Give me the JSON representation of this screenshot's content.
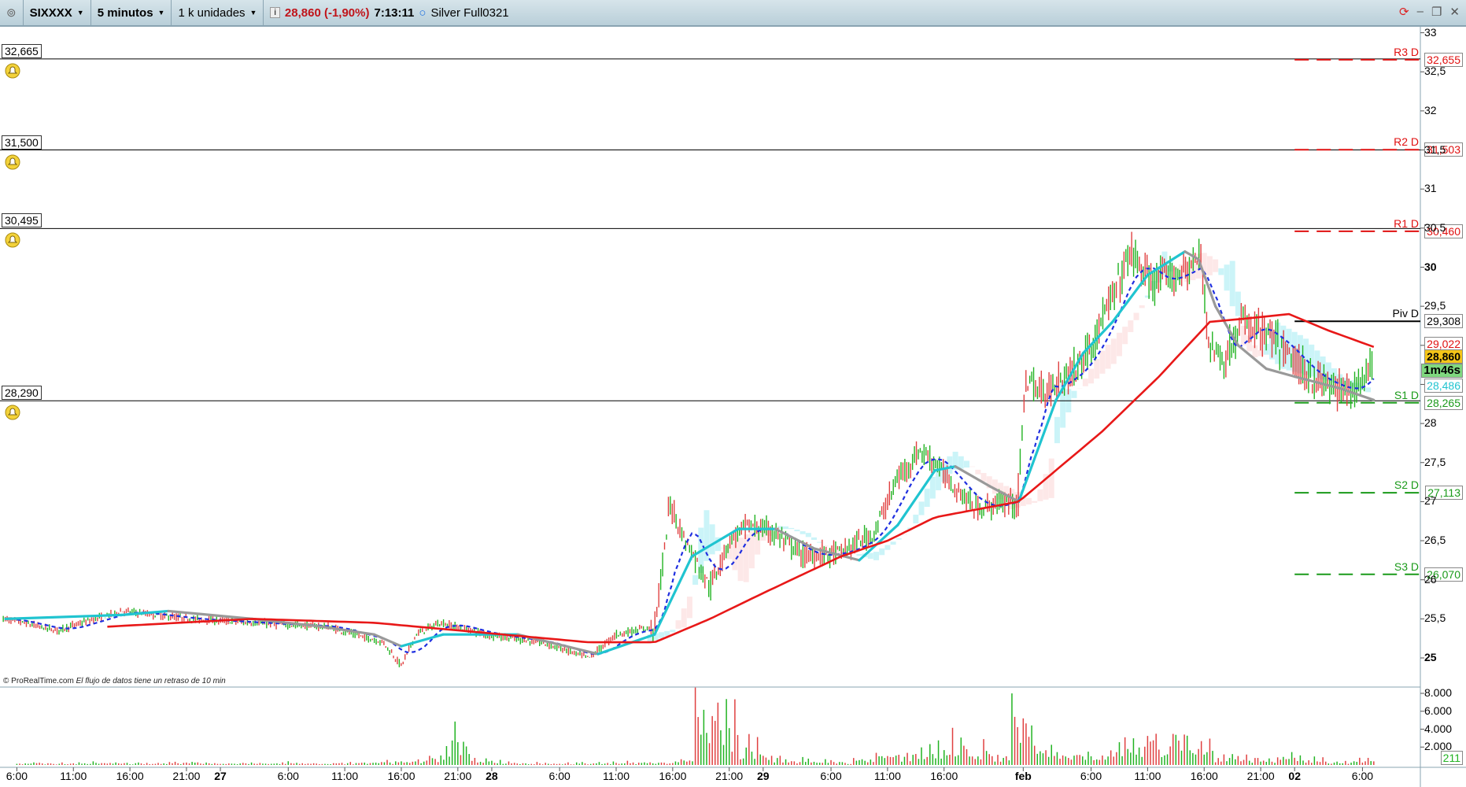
{
  "toolbar": {
    "symbol": "SIXXXX",
    "timeframe": "5 minutos",
    "units": "1 k unidades",
    "price": "28,860 (-1,90%)",
    "time": "7:13:11",
    "instrument": "Silver Full0321"
  },
  "credit": {
    "brand": "© ProRealTime.com",
    "note": "El flujo de datos tiene un retraso de 10 min"
  },
  "alerts": [
    {
      "label": "32,665",
      "value": 32.665
    },
    {
      "label": "31,500",
      "value": 31.5
    },
    {
      "label": "30,495",
      "value": 30.495
    },
    {
      "label": "28,290",
      "value": 28.29
    }
  ],
  "pivots": [
    {
      "name": "R3 D",
      "label": "32,655",
      "value": 32.655,
      "color": "#e01010"
    },
    {
      "name": "R2 D",
      "label": "31,503",
      "value": 31.503,
      "color": "#e01010"
    },
    {
      "name": "R1 D",
      "label": "30,460",
      "value": 30.46,
      "color": "#e01010"
    },
    {
      "name": "Piv D",
      "label": "29,308",
      "value": 29.308,
      "color": "#000000"
    },
    {
      "name": "S1 D",
      "label": "28,265",
      "value": 28.265,
      "color": "#1a9a1a"
    },
    {
      "name": "S2 D",
      "label": "27,113",
      "value": 27.113,
      "color": "#1a9a1a"
    },
    {
      "name": "S3 D",
      "label": "26,070",
      "value": 26.07,
      "color": "#1a9a1a"
    }
  ],
  "right_labels": {
    "ma_red": "29,022",
    "last": "28,860",
    "countdown": "1m46s",
    "ma_cyan": "28,486",
    "volume": "211"
  },
  "price_axis": [
    "33",
    "32,5",
    "32",
    "31,5",
    "31",
    "30,5",
    "30",
    "29,5",
    "29",
    "28,5",
    "28",
    "27,5",
    "27",
    "26,5",
    "26",
    "25,5",
    "25"
  ],
  "volume_axis": [
    "8.000",
    "6.000",
    "4.000",
    "2.000"
  ],
  "time_axis": [
    {
      "t": 0,
      "l": "6:00"
    },
    {
      "t": 5,
      "l": "11:00"
    },
    {
      "t": 10,
      "l": "16:00"
    },
    {
      "t": 15,
      "l": "21:00"
    },
    {
      "t": 18,
      "l": "27",
      "b": 1
    },
    {
      "t": 24,
      "l": "6:00"
    },
    {
      "t": 29,
      "l": "11:00"
    },
    {
      "t": 34,
      "l": "16:00"
    },
    {
      "t": 39,
      "l": "21:00"
    },
    {
      "t": 42,
      "l": "28",
      "b": 1
    },
    {
      "t": 48,
      "l": "6:00"
    },
    {
      "t": 53,
      "l": "11:00"
    },
    {
      "t": 58,
      "l": "16:00"
    },
    {
      "t": 63,
      "l": "21:00"
    },
    {
      "t": 66,
      "l": "29",
      "b": 1
    },
    {
      "t": 72,
      "l": "6:00"
    },
    {
      "t": 77,
      "l": "11:00"
    },
    {
      "t": 82,
      "l": "16:00"
    },
    {
      "t": 89,
      "l": "feb",
      "b": 1
    },
    {
      "t": 95,
      "l": "6:00"
    },
    {
      "t": 100,
      "l": "11:00"
    },
    {
      "t": 105,
      "l": "16:00"
    },
    {
      "t": 110,
      "l": "21:00"
    },
    {
      "t": 113,
      "l": "02",
      "b": 1
    },
    {
      "t": 119,
      "l": "6:00"
    }
  ],
  "chart_data": {
    "type": "line",
    "ylim": [
      25,
      33
    ],
    "volume_ylim": [
      0,
      8000
    ],
    "price": [
      [
        -1.1,
        25.5
      ],
      [
        3.5,
        25.35
      ],
      [
        9.3,
        25.6
      ],
      [
        15,
        25.5
      ],
      [
        20.8,
        25.45
      ],
      [
        27.4,
        25.4
      ],
      [
        32.4,
        25.2
      ],
      [
        34,
        24.9
      ],
      [
        35.3,
        25.3
      ],
      [
        37.4,
        25.45
      ],
      [
        41.5,
        25.3
      ],
      [
        46.4,
        25.2
      ],
      [
        50.6,
        25.0
      ],
      [
        53,
        25.3
      ],
      [
        56.4,
        25.4
      ],
      [
        57.4,
        26.5
      ],
      [
        57.7,
        27.0
      ],
      [
        58.8,
        26.6
      ],
      [
        61.3,
        25.9
      ],
      [
        63,
        26.5
      ],
      [
        64.6,
        26.7
      ],
      [
        67,
        26.6
      ],
      [
        69.6,
        26.3
      ],
      [
        72.9,
        26.35
      ],
      [
        75.8,
        26.6
      ],
      [
        77.9,
        27.3
      ],
      [
        79.9,
        27.65
      ],
      [
        81.2,
        27.5
      ],
      [
        82.8,
        27.2
      ],
      [
        84.9,
        26.9
      ],
      [
        88.6,
        27.05
      ],
      [
        89.2,
        28.6
      ],
      [
        90.2,
        28.4
      ],
      [
        91.9,
        28.5
      ],
      [
        94.3,
        28.8
      ],
      [
        96.9,
        29.6
      ],
      [
        98.5,
        30.2
      ],
      [
        100.2,
        29.8
      ],
      [
        102.6,
        29.9
      ],
      [
        104.7,
        30.1
      ],
      [
        105.5,
        29.0
      ],
      [
        106.8,
        28.8
      ],
      [
        108.4,
        29.3
      ],
      [
        110.9,
        29.1
      ],
      [
        114.2,
        28.6
      ],
      [
        117.5,
        28.4
      ],
      [
        118.8,
        28.5
      ],
      [
        120,
        28.86
      ]
    ],
    "ma_slow": [
      [
        8,
        25.4
      ],
      [
        20.8,
        25.5
      ],
      [
        31.6,
        25.45
      ],
      [
        50.6,
        25.2
      ],
      [
        56.4,
        25.2
      ],
      [
        61.3,
        25.5
      ],
      [
        66.3,
        25.85
      ],
      [
        72.9,
        26.3
      ],
      [
        77,
        26.5
      ],
      [
        81.2,
        26.8
      ],
      [
        88.6,
        27.0
      ],
      [
        96,
        27.9
      ],
      [
        101,
        28.6
      ],
      [
        105.5,
        29.3
      ],
      [
        109.2,
        29.35
      ],
      [
        112.5,
        29.4
      ],
      [
        115.8,
        29.2
      ],
      [
        120,
        28.98
      ]
    ],
    "ma_fast": [
      [
        -1,
        25.5
      ],
      [
        9.3,
        25.55
      ],
      [
        13.4,
        25.6
      ],
      [
        20.8,
        25.5
      ],
      [
        27,
        25.4
      ],
      [
        31.6,
        25.3
      ],
      [
        34,
        25.15
      ],
      [
        37.7,
        25.3
      ],
      [
        44.3,
        25.3
      ],
      [
        51.4,
        25.05
      ],
      [
        56.4,
        25.3
      ],
      [
        59.7,
        26.3
      ],
      [
        63.8,
        26.65
      ],
      [
        67.1,
        26.65
      ],
      [
        70.5,
        26.4
      ],
      [
        74.5,
        26.25
      ],
      [
        77.9,
        26.7
      ],
      [
        81.2,
        27.4
      ],
      [
        83,
        27.45
      ],
      [
        86,
        27.2
      ],
      [
        88.6,
        27.0
      ],
      [
        91.9,
        28.3
      ],
      [
        94.3,
        28.9
      ],
      [
        96.9,
        29.3
      ],
      [
        100,
        29.9
      ],
      [
        103.3,
        30.2
      ],
      [
        104.5,
        30.1
      ],
      [
        106,
        29.5
      ],
      [
        108,
        29.0
      ],
      [
        110.5,
        28.7
      ],
      [
        113,
        28.6
      ],
      [
        117,
        28.45
      ],
      [
        120,
        28.3
      ]
    ],
    "volume": [
      300,
      250,
      300,
      350,
      400,
      300,
      350,
      400,
      300,
      250,
      300,
      300,
      350,
      300,
      300,
      400,
      500,
      600,
      1500,
      4500,
      1200,
      500,
      300,
      300,
      250,
      300,
      350,
      400,
      500,
      800,
      8000,
      7000,
      3000,
      1200,
      800,
      600,
      500,
      900,
      1500,
      1800,
      2500,
      3500,
      2500,
      1500,
      8000,
      2500,
      1800,
      2000,
      2500,
      3000,
      4000,
      6500,
      3000,
      1500,
      1200,
      900,
      1200,
      800,
      600,
      700,
      500
    ]
  }
}
